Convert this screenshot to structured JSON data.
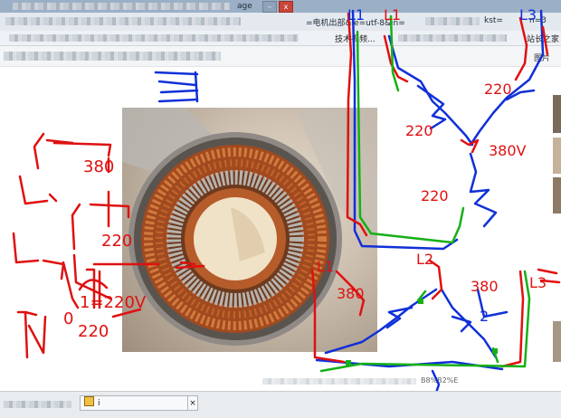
{
  "browser": {
    "title_fragment": "age",
    "url_fragment_1": "=电机出部&ie=utf-8&in=",
    "url_fragment_2": "kst=",
    "url_fragment_3": "n=3",
    "bookmark_1": "技术视频...",
    "bookmark_2": "站长之家",
    "toolbar_label": "图片",
    "minimize_label": "–",
    "close_label": "x",
    "status_url": "B8%B2%E",
    "task_label": "i"
  },
  "annotations": {
    "left_column": [
      "L1",
      "L2",
      "L3",
      "N"
    ],
    "left_values": [
      "380",
      "220",
      "1=220V",
      "0",
      "220"
    ],
    "top_labels": [
      "L1",
      "L1",
      "L3"
    ],
    "top_delta_values": [
      "220",
      "220",
      "220",
      "380V"
    ],
    "star_value": "220",
    "bottom_labels": [
      "L1",
      "L2",
      "380"
    ],
    "bottom_delta_values": [
      "380",
      "2",
      "380"
    ],
    "right_label": "L3",
    "colors": {
      "red": "#e01010",
      "blue": "#1030d8",
      "green": "#16b016"
    }
  }
}
